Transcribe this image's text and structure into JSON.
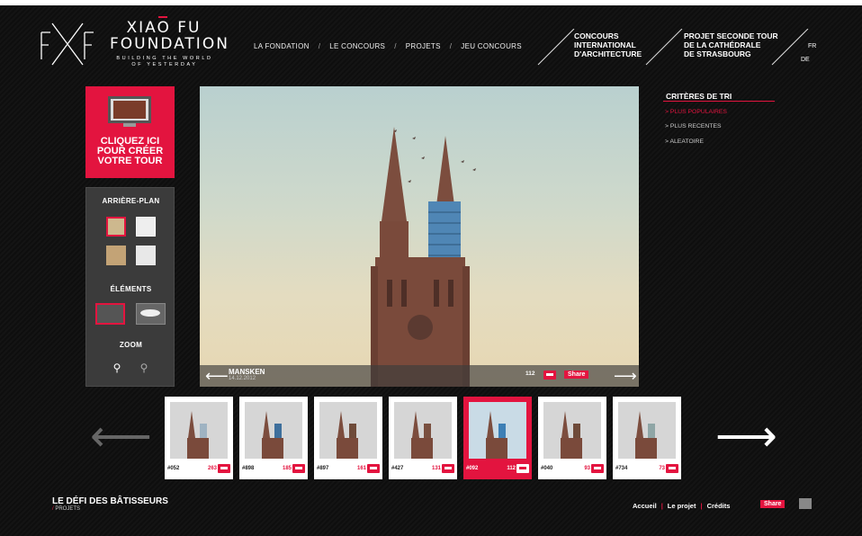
{
  "brand": {
    "title_line1": "XIAO FU",
    "title_line2": "FOUNDATION",
    "subtitle": "BUILDING THE WORLD OF YESTERDAY",
    "mark": "FXF"
  },
  "nav": {
    "items": [
      "LA FONDATION",
      "LE CONCOURS",
      "PROJETS",
      "JEU CONCOURS"
    ],
    "separator": "/"
  },
  "header_links": {
    "contest": [
      "CONCOURS",
      "INTERNATIONAL",
      "D'ARCHITECTURE"
    ],
    "project": [
      "PROJET SECONDE TOUR",
      "DE LA CATHÉDRALE",
      "DE STRASBOURG"
    ]
  },
  "languages": [
    "FR",
    "DE"
  ],
  "cta": {
    "lines": [
      "CLIQUEZ ICI",
      "POUR CRÉER",
      "VOTRE TOUR"
    ],
    "icon": "monitor-icon"
  },
  "tools": {
    "background_label": "ARRIÈRE-PLAN",
    "elements_label": "ÉLÉMENTS",
    "zoom_label": "ZOOM",
    "zoom_in_icon": "zoom-in-icon",
    "zoom_out_icon": "zoom-out-icon"
  },
  "stage": {
    "author": "MANSKEN",
    "date": "14.12.2012",
    "count": "112",
    "share_label": "Share",
    "prev_icon": "arrow-left-icon",
    "next_icon": "arrow-right-icon"
  },
  "sort": {
    "title": "CRITÈRES DE TRI",
    "options": [
      {
        "label": "> PLUS POPULAIRES",
        "active": true
      },
      {
        "label": "> PLUS RECENTES",
        "active": false
      },
      {
        "label": "> ALEATOIRE",
        "active": false
      }
    ]
  },
  "thumbnails": [
    {
      "id": "#052",
      "count": "263",
      "active": false,
      "tower": "#9fb3c2"
    },
    {
      "id": "#898",
      "count": "185",
      "active": false,
      "tower": "#3e6f9c"
    },
    {
      "id": "#897",
      "count": "161",
      "active": false,
      "tower": "#6f4b3a"
    },
    {
      "id": "#427",
      "count": "131",
      "active": false,
      "tower": "#7a5040"
    },
    {
      "id": "#092",
      "count": "112",
      "active": true,
      "tower": "#3d7fb5"
    },
    {
      "id": "#040",
      "count": "93",
      "active": false,
      "tower": "#6f4b3a"
    },
    {
      "id": "#734",
      "count": "73",
      "active": false,
      "tower": "#8fa6a6"
    }
  ],
  "footer": {
    "title": "LE DÉFI DES BÂTISSEURS",
    "breadcrumb": "PROJETS",
    "breadcrumb_sep": "/",
    "links": [
      "Accueil",
      "Le projet",
      "Crédits"
    ],
    "link_sep": "|",
    "share_label": "Share"
  },
  "colors": {
    "accent": "#e3143f",
    "background": "#0c0c0c",
    "panel": "#3b3b3b"
  }
}
